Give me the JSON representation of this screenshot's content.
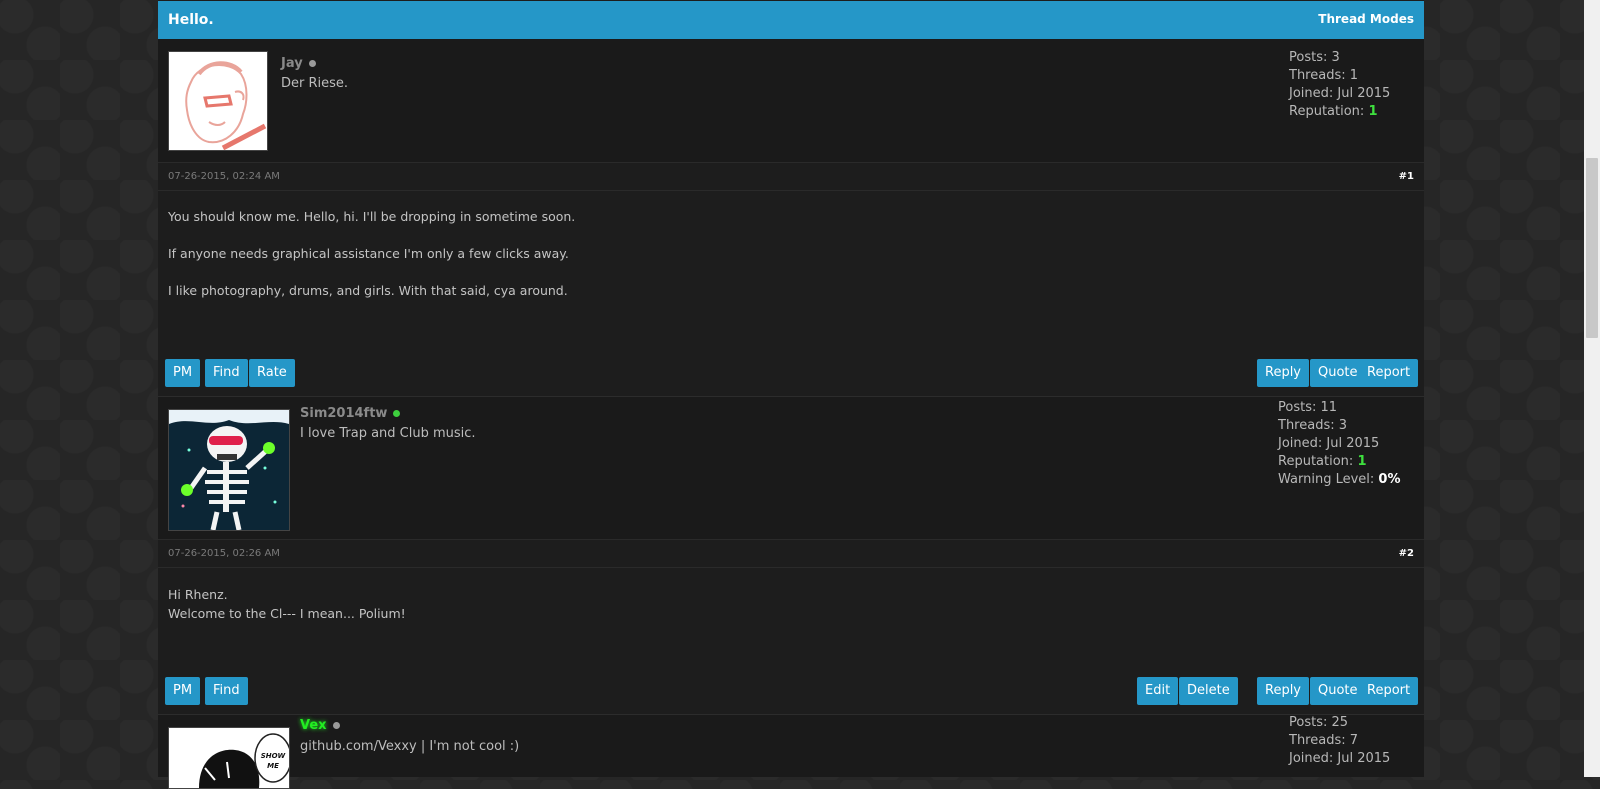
{
  "thread": {
    "title": "Hello.",
    "modes_label": "Thread Modes"
  },
  "posts": [
    {
      "username": "Jay",
      "online": false,
      "usertitle": "Der Riese.",
      "stats": {
        "posts_label": "Posts:",
        "posts": "3",
        "threads_label": "Threads:",
        "threads": "1",
        "joined_label": "Joined:",
        "joined": "Jul 2015",
        "reputation_label": "Reputation:",
        "reputation": "1"
      },
      "date": "07-26-2015, 02:24 AM",
      "number": "#1",
      "body": [
        "You should know me. Hello, hi. I'll be dropping in sometime soon.",
        "If anyone needs graphical assistance I'm only a few clicks away.",
        "I like photography, drums, and girls. With that said, cya around."
      ],
      "buttons_left": [
        "PM",
        "Find",
        "Rate"
      ],
      "buttons_right": [
        "Reply",
        "Quote",
        "Report"
      ]
    },
    {
      "username": "Sim2014ftw",
      "online": true,
      "usertitle": "I love Trap and Club music.",
      "stats": {
        "posts_label": "Posts:",
        "posts": "11",
        "threads_label": "Threads:",
        "threads": "3",
        "joined_label": "Joined:",
        "joined": "Jul 2015",
        "reputation_label": "Reputation:",
        "reputation": "1",
        "warning_label": "Warning Level:",
        "warning": "0%"
      },
      "date": "07-26-2015, 02:26 AM",
      "number": "#2",
      "body": [
        "Hi Rhenz.",
        "Welcome to the Cl--- I mean... Polium!"
      ],
      "buttons_left": [
        "PM",
        "Find"
      ],
      "buttons_right": [
        "Edit",
        "Delete",
        "Reply",
        "Quote",
        "Report"
      ]
    },
    {
      "username": "Vex",
      "online": false,
      "usertitle": "github.com/Vexxy | I'm not cool :)",
      "avatar_text": "SHOW ME",
      "stats": {
        "posts_label": "Posts:",
        "posts": "25",
        "threads_label": "Threads:",
        "threads": "7",
        "joined_label": "Joined:",
        "joined": "Jul 2015"
      }
    }
  ],
  "colors": {
    "accent": "#2597c8",
    "reputation": "#3ee03e",
    "online": "#3ecf3e",
    "offline": "#9a9a9a",
    "highlight_name": "#22ee22"
  }
}
